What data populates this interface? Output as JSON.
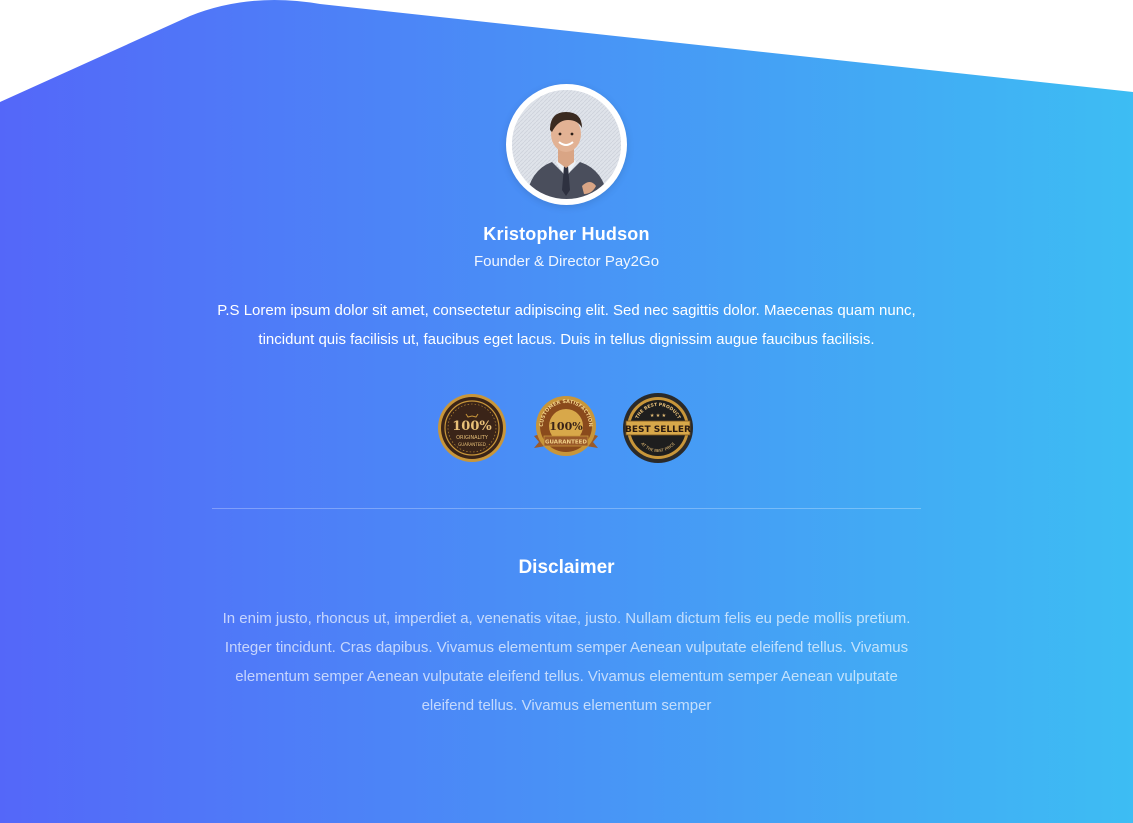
{
  "profile": {
    "name": "Kristopher Hudson",
    "role": "Founder & Director Pay2Go"
  },
  "message": {
    "text": "P.S Lorem ipsum dolor sit amet, consectetur adipiscing elit. Sed nec sagittis dolor. Maecenas quam nunc, tincidunt quis facilisis ut, faucibus eget lacus. Duis in tellus dignissim augue faucibus facilisis."
  },
  "badges": [
    {
      "icon": "originality-seal-icon",
      "line1": "100%",
      "line2": "ORIGINALITY",
      "line3": "GUARANTEED"
    },
    {
      "icon": "satisfaction-guaranteed-seal-icon",
      "line1": "CUSTOMER SATISFACTION",
      "line2": "100%",
      "line3": "GUARANTEED"
    },
    {
      "icon": "best-seller-seal-icon",
      "line1": "THE BEST PRODUCT",
      "line2": "BEST SELLER",
      "line3": "AT THE BEST PRICE"
    }
  ],
  "disclaimer": {
    "title": "Disclaimer",
    "text": "In enim justo, rhoncus ut, imperdiet a, venenatis vitae, justo. Nullam dictum felis eu pede mollis pretium. Integer tincidunt. Cras dapibus. Vivamus elementum semper Aenean vulputate eleifend tellus. Vivamus elementum semper Aenean vulputate eleifend tellus. Vivamus elementum semper Aenean vulputate eleifend tellus. Vivamus elementum semper"
  },
  "colors": {
    "gradient_start": "#5467f9",
    "gradient_end": "#3dbdf3",
    "gold": "#c8963a",
    "dark_seal": "#3a2418"
  }
}
